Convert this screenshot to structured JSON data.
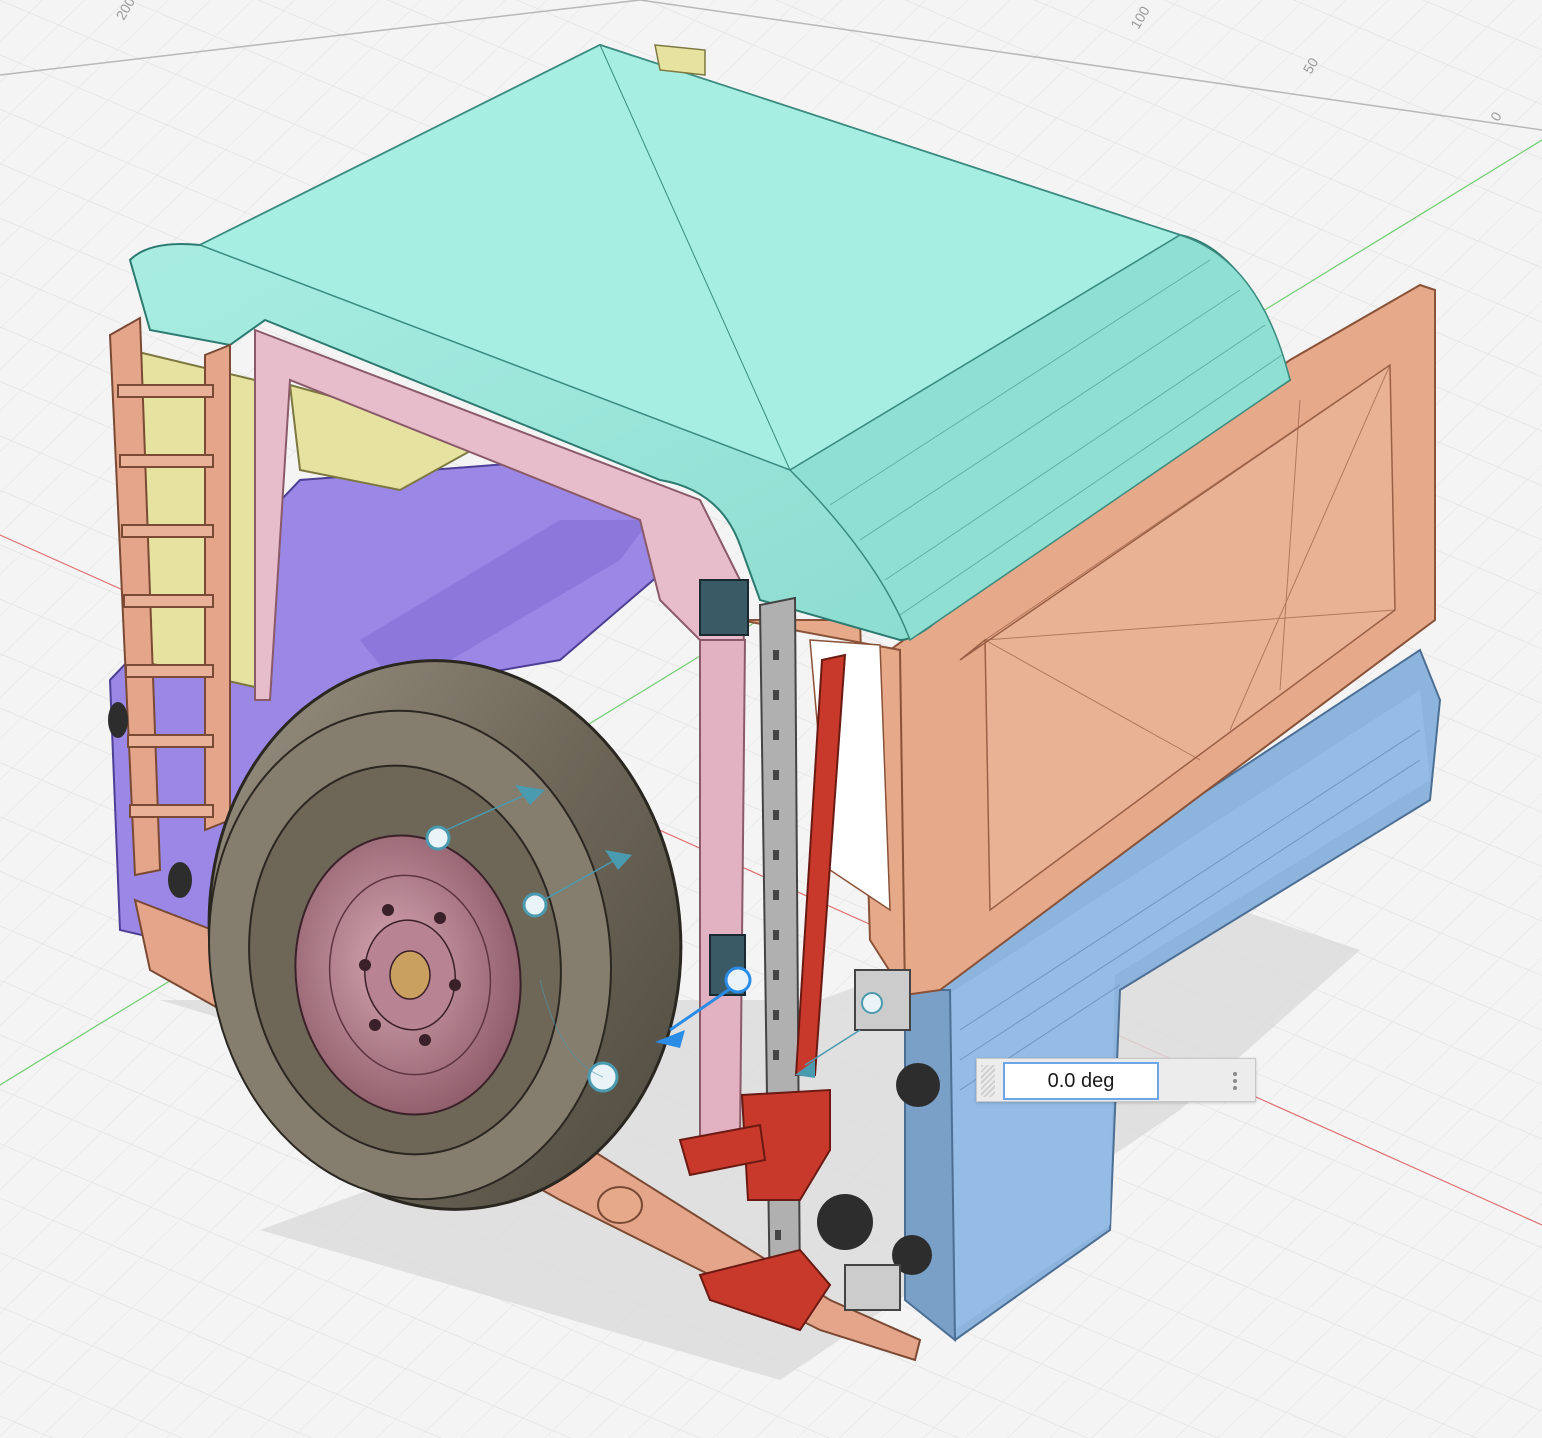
{
  "viewport": {
    "grid_labels": [
      "200",
      "100",
      "50",
      "0"
    ]
  },
  "angle_input": {
    "value": "0.0 deg"
  },
  "colors": {
    "roof": "#a3ece0",
    "front_panel": "#e6a98a",
    "lower_body": "#8db4dc",
    "side_purple": "#9b87e6",
    "side_yellow": "#e6e2a0",
    "pink_frame": "#e7bccb",
    "tire": "#7a7365",
    "rim": "#b98292",
    "jack": "#c8392b",
    "manipulator": "#2b8ce6"
  }
}
